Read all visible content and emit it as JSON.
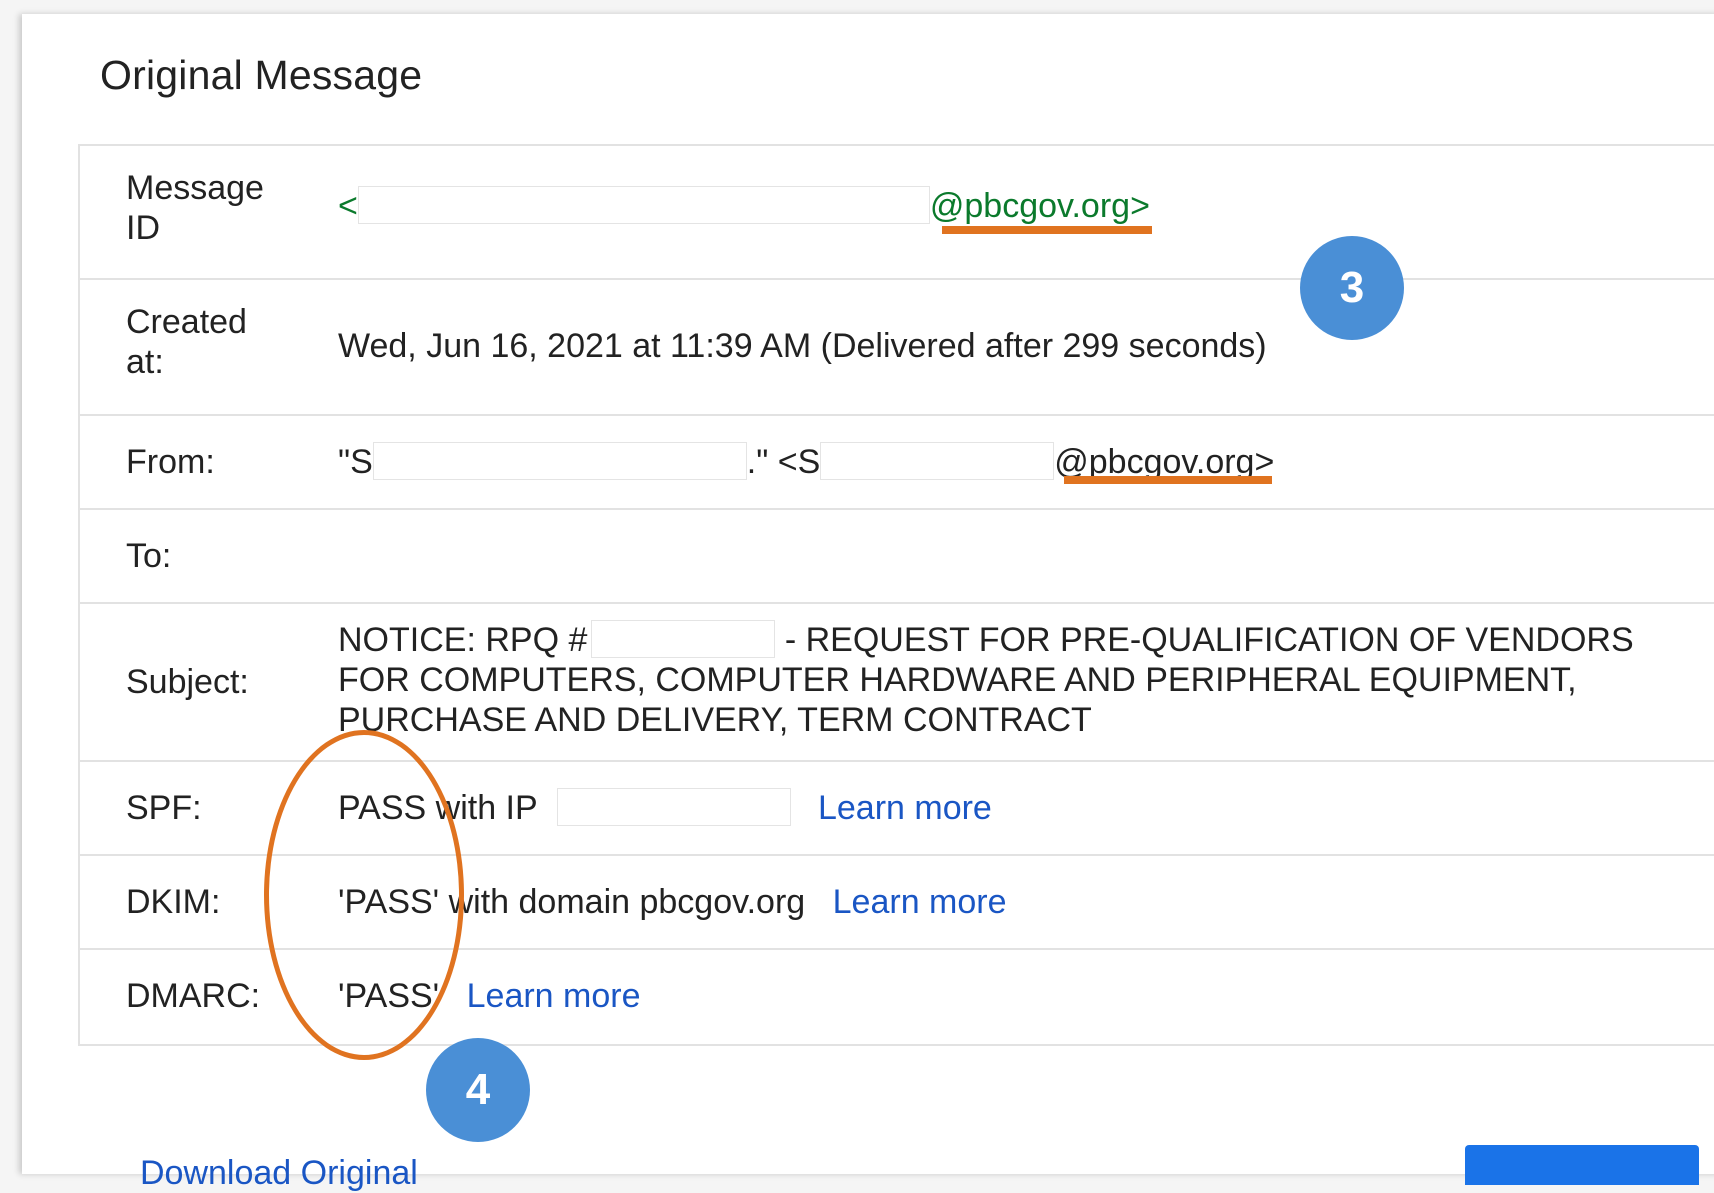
{
  "dialog": {
    "title": "Original Message"
  },
  "rows": {
    "message_id": {
      "label": "Message ID",
      "value_prefix": "<",
      "value_suffix": "@pbcgov.org>"
    },
    "created": {
      "label": "Created at:",
      "value": "Wed, Jun 16, 2021 at 11:39 AM (Delivered after 299 seconds)"
    },
    "from": {
      "label": "From:",
      "part1": "\"S",
      "part2": ".\" <S",
      "part3": "@pbcgov.org>"
    },
    "to": {
      "label": "To:"
    },
    "subject": {
      "label": "Subject:",
      "line1_prefix": "NOTICE: RPQ #",
      "line1_suffix": " - REQUEST FOR PRE-QUALIFICATION OF VENDORS",
      "line2": "FOR COMPUTERS, COMPUTER HARDWARE AND PERIPHERAL EQUIPMENT,",
      "line3": "PURCHASE AND DELIVERY, TERM CONTRACT"
    },
    "spf": {
      "label": "SPF:",
      "value": "PASS with IP",
      "link": "Learn more"
    },
    "dkim": {
      "label": "DKIM:",
      "value": "'PASS' with domain pbcgov.org",
      "link": "Learn more"
    },
    "dmarc": {
      "label": "DMARC:",
      "value": "'PASS'",
      "link": "Learn more"
    }
  },
  "annotations": {
    "badge_3": "3",
    "badge_4": "4",
    "accent_color": "#e07320",
    "badge_color": "#4a8fd6"
  },
  "footer": {
    "download_link": "Download Original"
  }
}
